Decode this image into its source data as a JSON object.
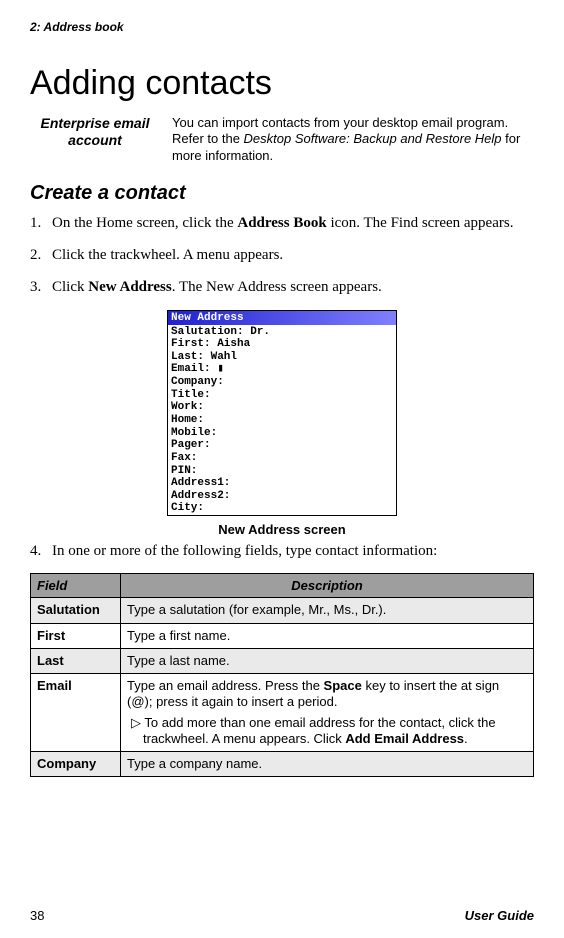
{
  "header": {
    "chapter": "2: Address book"
  },
  "title": "Adding contacts",
  "intro": {
    "label": "Enterprise email account",
    "text_before": "You can import contacts from your desktop email program. Refer to the ",
    "text_em": "Desktop Software: Backup and Restore Help",
    "text_after": " for more information."
  },
  "section_title": "Create a contact",
  "steps": [
    {
      "num": "1.",
      "parts": [
        "On the Home screen, click the ",
        "Address Book",
        " icon. The Find screen appears."
      ]
    },
    {
      "num": "2.",
      "parts": [
        "Click the trackwheel. A menu appears."
      ]
    },
    {
      "num": "3.",
      "parts": [
        "Click ",
        "New Address",
        ". The New Address screen appears."
      ]
    },
    {
      "num": "4.",
      "parts": [
        "In one or more of the following fields, type contact information:"
      ]
    }
  ],
  "screenshot": {
    "title": "New Address",
    "lines": [
      "Salutation: Dr.",
      "First: Aisha",
      "Last: Wahl",
      "Email: ▮",
      "Company:",
      "Title:",
      "Work:",
      "Home:",
      "Mobile:",
      "Pager:",
      "Fax:",
      "PIN:",
      "Address1:",
      "Address2:",
      "City:"
    ],
    "caption": "New Address screen"
  },
  "table": {
    "headers": [
      "Field",
      "Description"
    ],
    "rows": [
      {
        "field": "Salutation",
        "desc": "Type a salutation (for example, Mr., Ms., Dr.).",
        "shaded": true
      },
      {
        "field": "First",
        "desc": "Type a first name.",
        "shaded": false
      },
      {
        "field": "Last",
        "desc": "Type a last name.",
        "shaded": true
      },
      {
        "field": "Email",
        "shaded": false,
        "email": {
          "line1_a": "Type an email address. Press the ",
          "line1_b": "Space",
          "line1_c": " key to insert the at sign (@); press it again to insert a period.",
          "note_prefix": "▷",
          "note_a": "To add more than one email address for the contact, click the trackwheel. A menu appears. Click ",
          "note_b": "Add Email Address",
          "note_c": "."
        }
      },
      {
        "field": "Company",
        "desc": "Type a company name.",
        "shaded": true
      }
    ]
  },
  "footer": {
    "page": "38",
    "label": "User Guide"
  }
}
